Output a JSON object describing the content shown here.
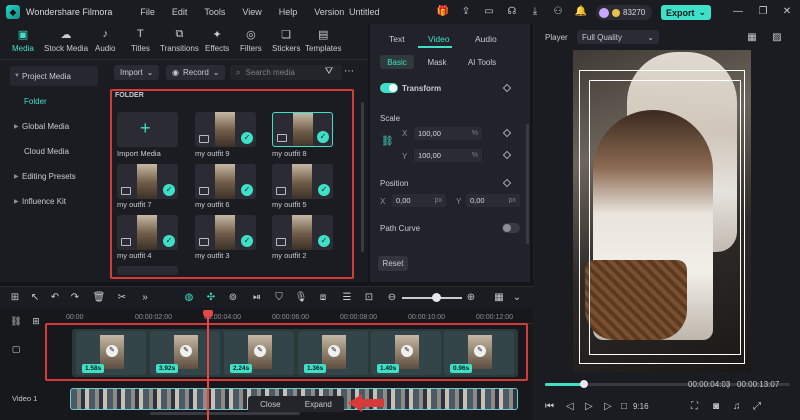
{
  "app": {
    "title": "Wondershare Filmora",
    "doc_title": "Untitled",
    "credits": "83270",
    "export_label": "Export"
  },
  "menu": [
    "File",
    "Edit",
    "Tools",
    "View",
    "Help",
    "Version"
  ],
  "toolbar": [
    "Media",
    "Stock Media",
    "Audio",
    "Titles",
    "Transitions",
    "Effects",
    "Filters",
    "Stickers",
    "Templates"
  ],
  "leftnav": [
    "Project Media",
    "Folder",
    "Global Media",
    "Cloud Media",
    "Editing Presets",
    "Influence Kit"
  ],
  "mediabar": {
    "import": "Import",
    "record": "Record",
    "search_placeholder": "Search media"
  },
  "media": {
    "folder_label": "FOLDER",
    "import_label": "Import Media",
    "items": [
      "my outfit 9",
      "my outfit 8",
      "my outfit 7",
      "my outfit 6",
      "my outfit 5",
      "my outfit 4",
      "my outfit 3",
      "my outfit 2"
    ]
  },
  "inspector": {
    "tabs": [
      "Text",
      "Video",
      "Audio"
    ],
    "subtabs": [
      "Basic",
      "Mask",
      "AI Tools"
    ],
    "transform": "Transform",
    "scale": "Scale",
    "x_label": "X",
    "y_label": "Y",
    "scale_x": "100,00",
    "scale_y": "100,00",
    "pct": "%",
    "position": "Position",
    "pos_x": "0,00",
    "pos_y": "0,00",
    "px": "px",
    "path_curve": "Path Curve",
    "reset": "Reset"
  },
  "player": {
    "label": "Player",
    "quality": "Full Quality",
    "current_time": "00:00:04:03",
    "total_time": "00:00:13:07",
    "progress": 0.16,
    "ratio": "9:16"
  },
  "timeline": {
    "ruler": [
      "00:00",
      "00:00:02:00",
      "00:00:04:00",
      "00:00:06:00",
      "00:00:08:00",
      "00:00:10:00",
      "00:00:12:00"
    ],
    "clip_durations": [
      "1.58s",
      "3.92s",
      "2.24s",
      "1.36s",
      "1.40s",
      "0.96s"
    ],
    "video_label": "Video 1",
    "close_label": "Close",
    "expand_label": "Expand"
  }
}
